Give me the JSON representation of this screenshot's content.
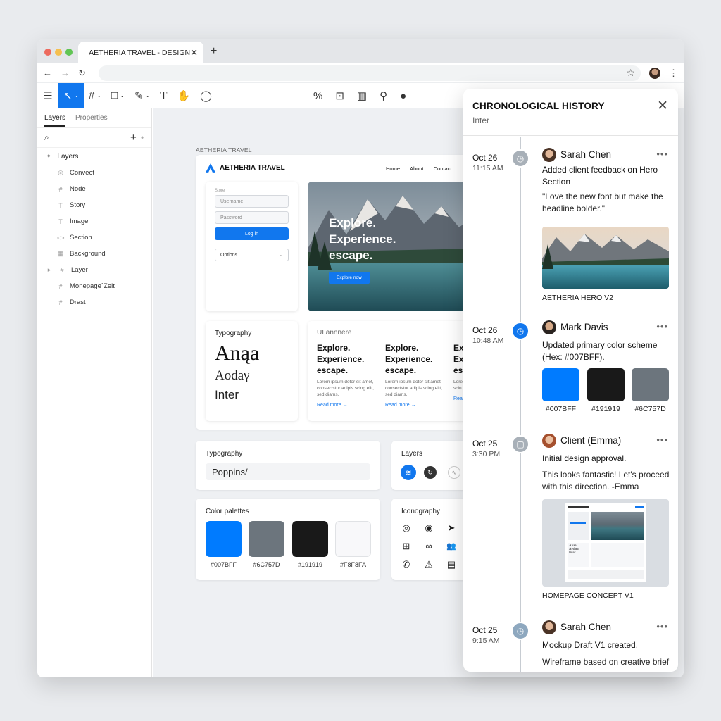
{
  "browser": {
    "tab_title": "AETHERIA TRAVEL - DESIGN",
    "tab_close": "✕",
    "new_tab": "+",
    "back": "←",
    "forward": "→",
    "reload": "↻",
    "star": "☆",
    "menu": "⋮",
    "traffic_colors": [
      "#ed6a5e",
      "#f5bf4f",
      "#61c554"
    ]
  },
  "toolbar": {
    "menu": "☰",
    "move": "↖",
    "frame": "#",
    "rect": "□",
    "pen": "✎",
    "text": "T",
    "hand": "✋",
    "comment": "◯",
    "center_icons": [
      "%",
      "⊡",
      "▥",
      "⚲",
      "●"
    ]
  },
  "sidebar": {
    "tabs": [
      "Layers",
      "Properties"
    ],
    "add": "+",
    "search_icon": "⌕",
    "layers_header": "Layers",
    "items": [
      {
        "icon": "◎",
        "label": "Convect"
      },
      {
        "icon": "#",
        "label": "Node"
      },
      {
        "icon": "T",
        "label": "Story"
      },
      {
        "icon": "T",
        "label": "Image"
      },
      {
        "icon": "<>",
        "label": "Section"
      },
      {
        "icon": "▦",
        "label": "Background"
      },
      {
        "icon": "▸",
        "label": "Layer"
      },
      {
        "icon": "#",
        "label": "Monepage`Zeit"
      },
      {
        "icon": "#",
        "label": "Drast"
      }
    ]
  },
  "canvas": {
    "frame_label": "AETHERIA TRAVEL",
    "site": {
      "brand": "AETHERIA TRAVEL",
      "nav": [
        "Home",
        "About",
        "Contact"
      ],
      "login": {
        "small_label": "Store",
        "username": "Username",
        "password": "Password",
        "button": "Log in",
        "options": "Options"
      },
      "hero": {
        "line1": "Explore.",
        "line2": "Experience.",
        "line3": "escape.",
        "button": "Explore now"
      },
      "typography": {
        "title": "Typography",
        "sample1": "Anąa",
        "sample2": "Aodaγ",
        "sample3": "Inter"
      },
      "ui_card": {
        "title": "UI annnere",
        "cards": [
          {
            "h1": "Explore.",
            "h2": "Experience.",
            "h3": "escape.",
            "p": "Lorem ipsum dotor sit amet, consectstur adipis scing elit, sed diams.",
            "more": "Read more →"
          },
          {
            "h1": "Explore.",
            "h2": "Experience.",
            "h3": "escape.",
            "p": "Lorem ipsum dotor sit amet, consectstur adipis scing elit, sed diams.",
            "more": "Read more →"
          },
          {
            "h1": "Ex",
            "h2": "Ex",
            "h3": "es",
            "p": "Lore ame scin",
            "more": "Rea"
          }
        ]
      }
    },
    "typography_card": {
      "title": "Typography",
      "font": "Poppins/"
    },
    "layers_card": {
      "title": "Layers"
    },
    "palette_card": {
      "title": "Color palettes",
      "swatches": [
        {
          "hex": "#007BFF",
          "label": "#007BFF"
        },
        {
          "hex": "#6C757D",
          "label": "#6C757D"
        },
        {
          "hex": "#191919",
          "label": "#191919"
        },
        {
          "hex": "#F8F8FA",
          "label": "#F8F8FA"
        }
      ]
    },
    "iconography_card": {
      "title": "Iconography",
      "icons": [
        "◎",
        "◉",
        "➤",
        "⊞",
        "∞",
        "👥",
        "✆",
        "⚠",
        "▤"
      ]
    }
  },
  "history": {
    "title": "CHRONOLOGICAL HISTORY",
    "subtitle": "Inter",
    "close": "✕",
    "more": "•••",
    "entries": [
      {
        "date": "Oct 26",
        "time": "11:15 AM",
        "author": "Sarah Chen",
        "title": "Added client feedback on Hero Section",
        "body": "\"Love the new font but make the headline bolder.\"",
        "caption": "AETHERIA HERO V2"
      },
      {
        "date": "Oct 26",
        "time": "10:48 AM",
        "author": "Mark Davis",
        "title": "Updated primary color scheme (Hex: #007BFF).",
        "swatches": [
          {
            "hex": "#007BFF",
            "label": "#007BFF"
          },
          {
            "hex": "#191919",
            "label": "#191919"
          },
          {
            "hex": "#6C757D",
            "label": "#6C757D"
          }
        ]
      },
      {
        "date": "Oct 25",
        "time": "3:30 PM",
        "author": "Client (Emma)",
        "title": "Initial design approval.",
        "body": "This looks fantastic! Let's proceed with this direction. -Emma",
        "caption": "HOMEPAGE CONCEPT V1"
      },
      {
        "date": "Oct 25",
        "time": "9:15 AM",
        "author": "Sarah Chen",
        "title": "Mockup Draft V1 created.",
        "body": "Wireframe based on creative brief"
      }
    ]
  }
}
